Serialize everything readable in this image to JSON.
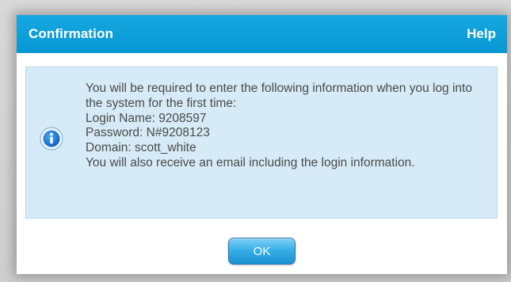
{
  "dialog": {
    "title": "Confirmation",
    "help_label": "Help",
    "icon": "info-icon",
    "message_lines": [
      "You will be required to enter the following information when you log into the system for the first time:",
      "Login Name: 9208597",
      "Password: N#9208123",
      "Domain: scott_white",
      "You will also receive an email including the login information."
    ],
    "ok_label": "OK"
  },
  "colors": {
    "titlebar": "#0796d2",
    "info_background": "#d6ebf7",
    "button": "#36aee6"
  }
}
